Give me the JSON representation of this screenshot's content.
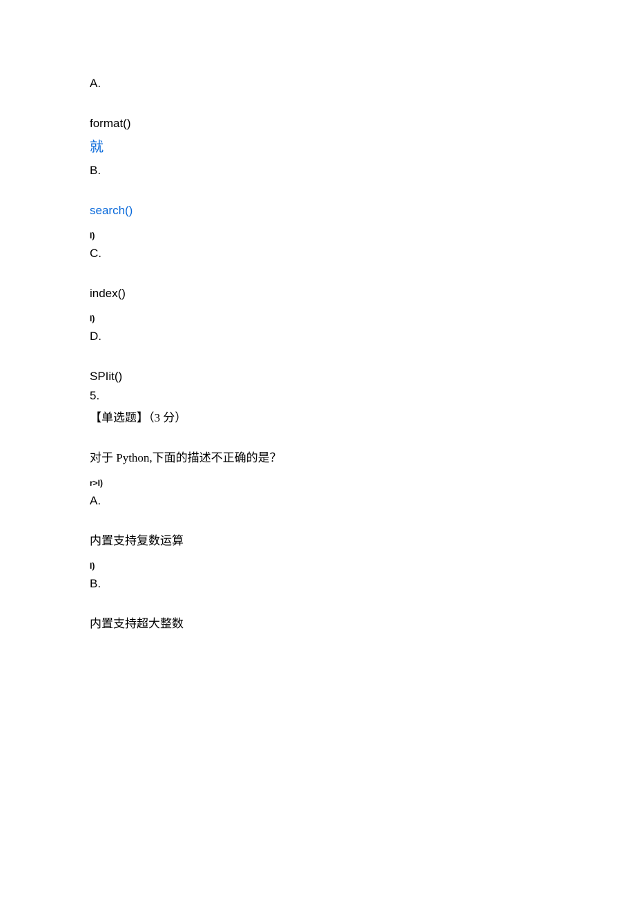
{
  "q4": {
    "options": {
      "a_label": "A.",
      "a_text": "format()",
      "a_annot": "就",
      "b_label": "B.",
      "b_text": "search()",
      "b_annot": "I)",
      "c_label": "C.",
      "c_text": "index()",
      "c_annot": "I)",
      "d_label": "D.",
      "d_text": "SPIit()"
    }
  },
  "q5": {
    "number": "5.",
    "header": "【单选题】（3 分）",
    "stem": "对于 Python,下面的描述不正确的是？",
    "annot_pre_a": "r>I)",
    "options": {
      "a_label": "A.",
      "a_text": "内置支持复数运算",
      "a_annot": "I)",
      "b_label": "B.",
      "b_text": "内置支持超大整数"
    }
  }
}
